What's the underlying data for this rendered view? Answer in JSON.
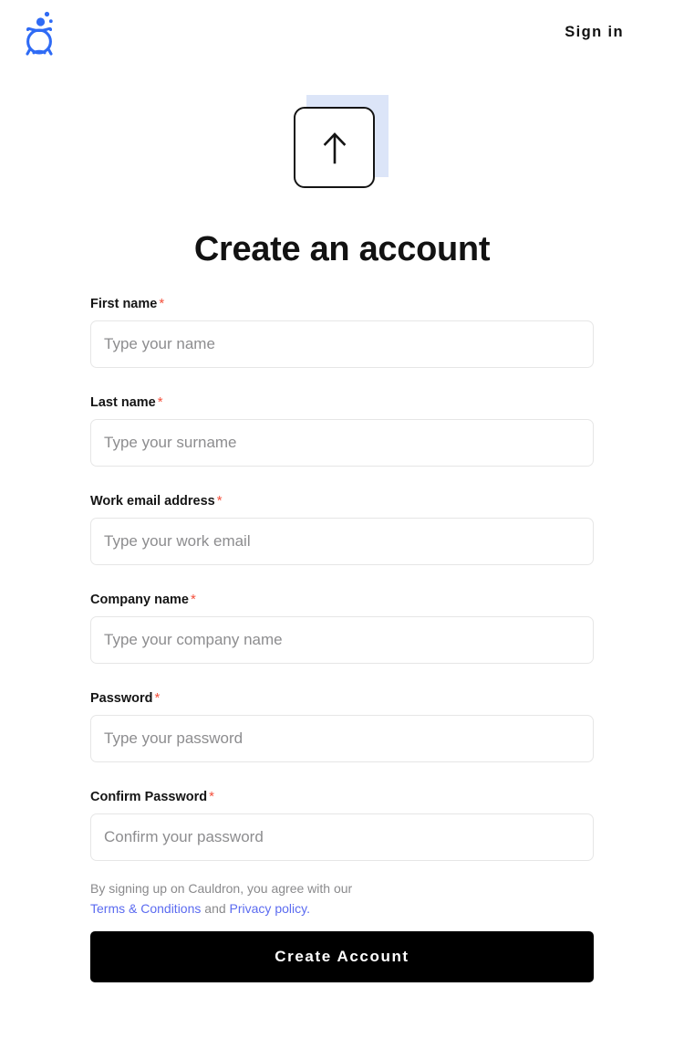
{
  "header": {
    "logo_icon": "cauldron-logo-icon",
    "brand_color": "#2f6bf5",
    "signin_label": "Sign in"
  },
  "badge": {
    "icon": "arrow-up-icon",
    "shadow_color": "#dce5f8",
    "border_color": "#141414"
  },
  "main": {
    "title": "Create an account"
  },
  "form": {
    "required_marker": "*",
    "fields": [
      {
        "label": "First name",
        "placeholder": "Type your name",
        "type": "text",
        "name": "first-name"
      },
      {
        "label": "Last name",
        "placeholder": "Type your surname",
        "type": "text",
        "name": "last-name"
      },
      {
        "label": "Work email address",
        "placeholder": "Type your work email",
        "type": "email",
        "name": "work-email"
      },
      {
        "label": "Company name",
        "placeholder": "Type your company name",
        "type": "text",
        "name": "company-name"
      },
      {
        "label": "Password",
        "placeholder": "Type your password",
        "type": "password",
        "name": "password"
      },
      {
        "label": "Confirm Password",
        "placeholder": "Confirm your password",
        "type": "password",
        "name": "confirm-password"
      }
    ]
  },
  "terms": {
    "lead_text": "By signing up on Cauldron, you agree with our",
    "terms_link": "Terms & Conditions",
    "conjunction": "and",
    "privacy_link": "Privacy policy.",
    "link_color": "#5b6bf0"
  },
  "submit": {
    "label": "Create Account",
    "background": "#000000"
  }
}
